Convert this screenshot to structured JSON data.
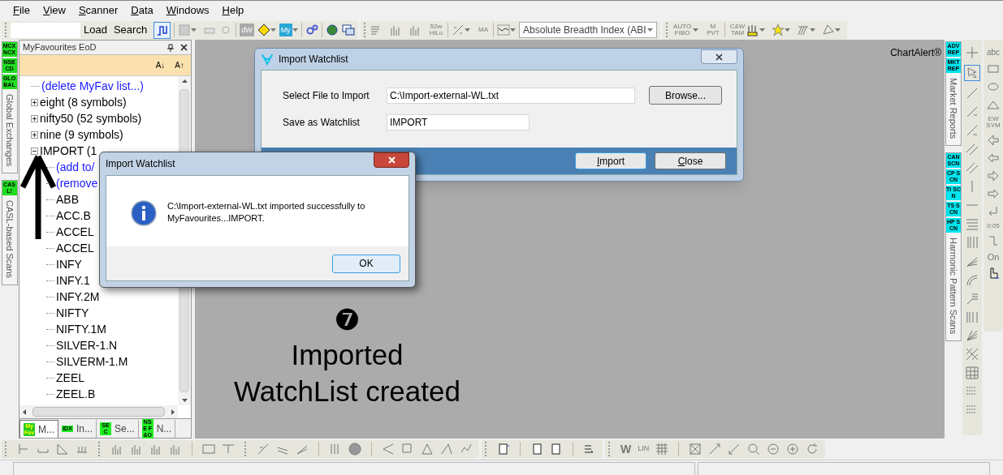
{
  "menu": [
    "File",
    "View",
    "Scanner",
    "Data",
    "Windows",
    "Help"
  ],
  "toolbar": {
    "buttons": [
      "Load",
      "Search"
    ],
    "glyphs": [
      "dW",
      "My",
      "52w HiLo",
      "MA",
      "AUTO FIBO",
      "M PVT",
      "C&W TAM"
    ],
    "indicator_select": {
      "value": "Absolute Breadth Index (ABI"
    }
  },
  "brand": "ChartAlert®",
  "left_strip": {
    "groups": [
      {
        "badges": [
          "MCX NCX",
          "NSE CD",
          "GLOBAL"
        ],
        "label": "Global Exchanges"
      },
      {
        "badges": [
          "CASL!"
        ],
        "label": "CASL-based Scans"
      }
    ]
  },
  "panel": {
    "title": "MyFavourites EoD",
    "sort_buttons": [
      "A↓",
      "A↑"
    ],
    "tree": [
      {
        "label": "(delete MyFav list...)",
        "kind": "action"
      },
      {
        "label": "eight (8 symbols)",
        "kind": "list",
        "expanded": false
      },
      {
        "label": "nifty50 (52 symbols)",
        "kind": "list",
        "expanded": false
      },
      {
        "label": "nine (9 symbols)",
        "kind": "list",
        "expanded": false
      },
      {
        "label": "IMPORT (1",
        "kind": "list",
        "expanded": true,
        "children": [
          {
            "label": "(add to/",
            "kind": "action"
          },
          {
            "label": "(remove",
            "kind": "action"
          },
          {
            "label": "ABB",
            "kind": "symbol"
          },
          {
            "label": "ACC.B",
            "kind": "symbol"
          },
          {
            "label": "ACCEL",
            "kind": "symbol"
          },
          {
            "label": "ACCEL",
            "kind": "symbol"
          },
          {
            "label": "INFY",
            "kind": "symbol"
          },
          {
            "label": "INFY.1",
            "kind": "symbol"
          },
          {
            "label": "INFY.2M",
            "kind": "symbol"
          },
          {
            "label": "NIFTY",
            "kind": "symbol"
          },
          {
            "label": "NIFTY.1M",
            "kind": "symbol"
          },
          {
            "label": "SILVER-1.N",
            "kind": "symbol"
          },
          {
            "label": "SILVERM-1.M",
            "kind": "symbol"
          },
          {
            "label": "ZEEL",
            "kind": "symbol"
          },
          {
            "label": "ZEEL.B",
            "kind": "symbol"
          }
        ]
      }
    ],
    "tabs": [
      {
        "badge": "My Fav",
        "label": "M...",
        "selected": true
      },
      {
        "badge": "IDX",
        "label": "In...",
        "selected": false
      },
      {
        "badge": "SEC",
        "label": "Se...",
        "selected": false
      },
      {
        "badge": "NSE F&O",
        "label": "N...",
        "selected": false
      }
    ]
  },
  "right_strip": {
    "groups": [
      {
        "badges": [
          "ADV REP",
          "MKT REP"
        ],
        "label": "Market Reports"
      },
      {
        "badges": [
          "CAN SCN",
          "CP SCN",
          "TI SCN",
          "TS SCN",
          "HP SCN"
        ],
        "label": "Harmonic Pattern Scans"
      }
    ]
  },
  "drawing_tools": {
    "glyphs": [
      "abc",
      "EW SYM",
      "0:05",
      "On"
    ]
  },
  "bottom_toolbar": {
    "glyphs": [
      "W",
      "LIN"
    ]
  },
  "import_dialog": {
    "title": "Import Watchlist",
    "fields": [
      {
        "label": "Select File to Import",
        "value": "C:\\Import-external-WL.txt"
      },
      {
        "label": "Save as Watchlist",
        "value": "IMPORT"
      }
    ],
    "browse_button": "Browse...",
    "buttons": [
      "Import",
      "Close"
    ]
  },
  "message_box": {
    "title": "Import Watchlist",
    "message": "C:\\Import-external-WL.txt imported successfully to MyFavourites...IMPORT.",
    "button": "OK"
  },
  "annotation": {
    "step": "❼",
    "caption": "Imported WatchList created"
  }
}
